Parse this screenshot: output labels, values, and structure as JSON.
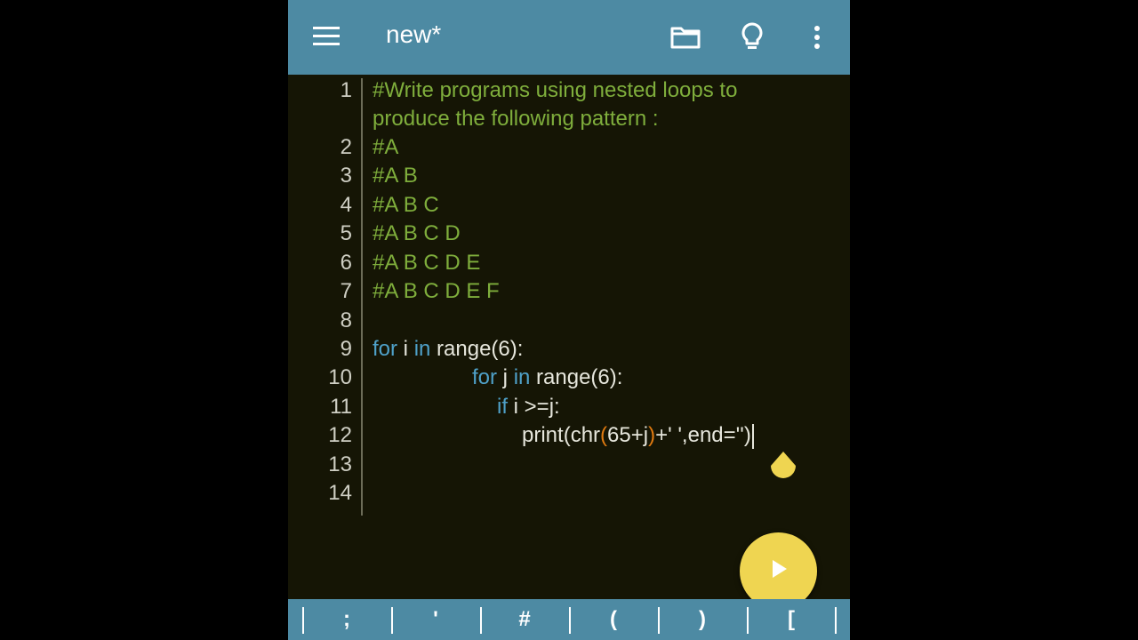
{
  "appbar": {
    "title": "new*",
    "icons": [
      "menu-icon",
      "folder-icon",
      "lightbulb-icon",
      "more-vert-icon"
    ]
  },
  "editor": {
    "line_numbers": [
      "1",
      "2",
      "3",
      "4",
      "5",
      "6",
      "7",
      "8",
      "9",
      "10",
      "11",
      "12",
      "13",
      "14"
    ],
    "comment_line1a": "#Write programs using nested loops to",
    "comment_line1b": "produce the following pattern :",
    "pattern_lines": [
      "#A",
      "#A B",
      "#A B C",
      "#A B C D",
      "#A B C D E",
      "#A B C D E F"
    ],
    "code": {
      "line9": {
        "kw_for": "for",
        "var": " i ",
        "kw_in": "in",
        "rest": " range(6):"
      },
      "line10": {
        "kw_for": "for",
        "var": " j ",
        "kw_in": "in",
        "rest": " range(6):"
      },
      "line11": {
        "kw_if": "if",
        "rest": " i >=j:"
      },
      "line12": {
        "fn": "print",
        "open": "(",
        "call": "chr",
        "open2": "(",
        "arg": "65+j",
        "close2": ")",
        "tail": "+' ',end=''",
        "close": ")"
      }
    }
  },
  "run_button": {
    "icon": "play-icon"
  },
  "keybar": {
    "keys": [
      ";",
      "'",
      "#",
      "(",
      ")",
      "["
    ]
  },
  "colors": {
    "appbar": "#4d8aa3",
    "editor_bg": "#151505",
    "comment": "#7fae3c",
    "keyword": "#4fa1c9",
    "paren": "#e07a10",
    "run_button": "#efd551"
  }
}
